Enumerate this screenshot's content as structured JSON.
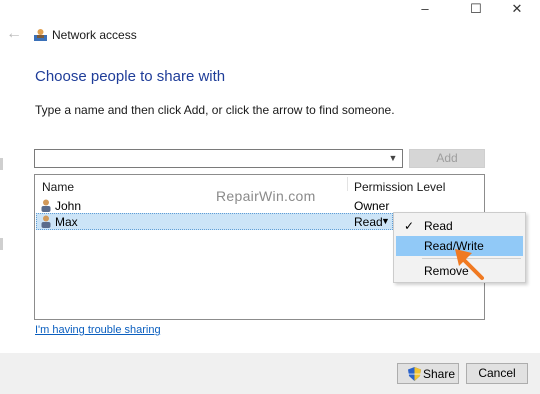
{
  "window": {
    "title": "Network access",
    "controls": {
      "minimize": "–",
      "maximize": "☐",
      "close": "✕"
    }
  },
  "header": {
    "heading": "Choose people to share with",
    "instruction": "Type a name and then click Add, or click the arrow to find someone."
  },
  "search": {
    "value": "",
    "add_label": "Add"
  },
  "table": {
    "columns": [
      "Name",
      "Permission Level"
    ],
    "rows": [
      {
        "name": "John",
        "permission": "Owner"
      },
      {
        "name": "Max",
        "permission": "Read"
      }
    ]
  },
  "watermark": "RepairWin.com",
  "permission_menu": {
    "items": [
      {
        "label": "Read",
        "checked": true
      },
      {
        "label": "Read/Write",
        "highlighted": true
      },
      {
        "label": "Remove"
      }
    ]
  },
  "links": {
    "trouble": "I'm having trouble sharing"
  },
  "footer": {
    "share_label": "Share",
    "cancel_label": "Cancel"
  },
  "colors": {
    "heading": "#1f3d99",
    "selection": "#cce4f7",
    "menu_highlight": "#91c9f7",
    "link": "#0b5fbf",
    "pointer_arrow": "#f07a22"
  }
}
